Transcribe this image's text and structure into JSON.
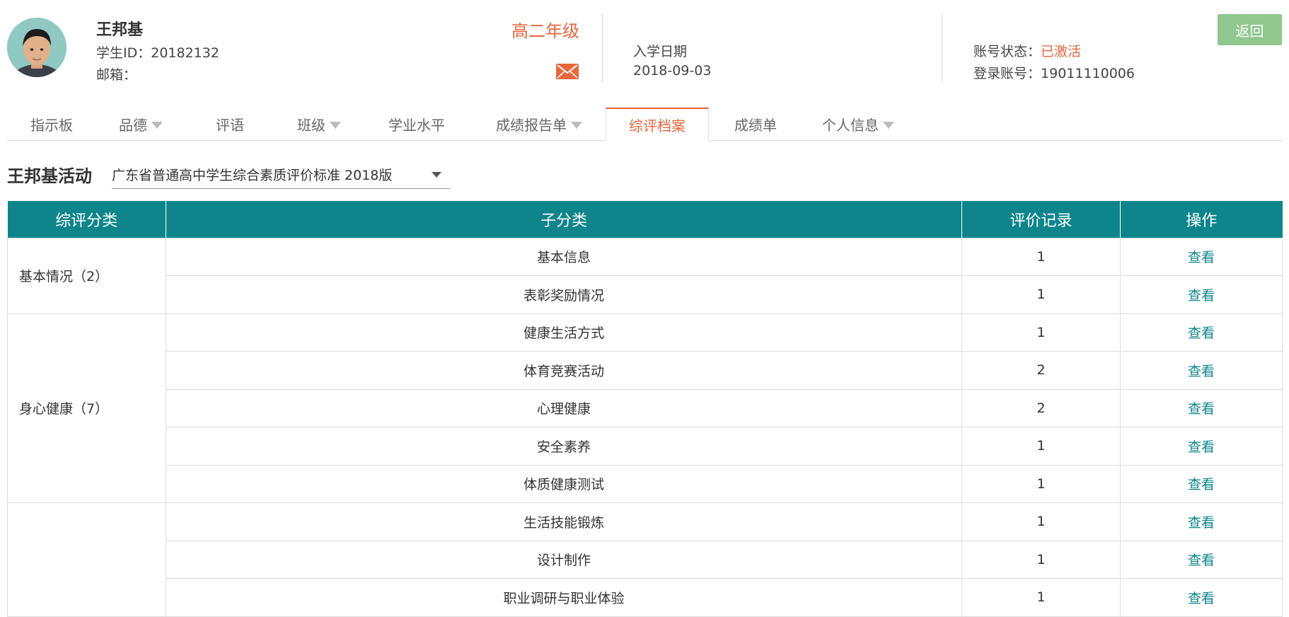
{
  "student": {
    "name": "王邦基",
    "id_text": "学生ID：20182132",
    "email_label": "邮箱：",
    "grade": "高二年级",
    "enroll_label": "入学日期",
    "enroll_date": "2018-09-03",
    "status_label": "账号状态：",
    "status_value": "已激活",
    "login_label": "登录账号：",
    "login_value": "19011110006"
  },
  "header": {
    "back_label": "返回"
  },
  "tabs": [
    {
      "label": "指示板",
      "dropdown": false
    },
    {
      "label": "品德",
      "dropdown": true
    },
    {
      "label": "评语",
      "dropdown": false
    },
    {
      "label": "班级",
      "dropdown": true
    },
    {
      "label": "学业水平",
      "dropdown": false
    },
    {
      "label": "成绩报告单",
      "dropdown": true
    },
    {
      "label": "综评档案",
      "dropdown": false,
      "active": true
    },
    {
      "label": "成绩单",
      "dropdown": false
    },
    {
      "label": "个人信息",
      "dropdown": true
    }
  ],
  "section": {
    "title": "王邦基活动",
    "standard": "广东省普通高中学生综合素质评价标准 2018版"
  },
  "table": {
    "headers": [
      "综评分类",
      "子分类",
      "评价记录",
      "操作"
    ],
    "groups": [
      {
        "category": "基本情况（2）",
        "rows": [
          {
            "sub": "基本信息",
            "count": "1",
            "action": "查看"
          },
          {
            "sub": "表彰奖励情况",
            "count": "1",
            "action": "查看"
          }
        ]
      },
      {
        "category": "身心健康（7）",
        "rows": [
          {
            "sub": "健康生活方式",
            "count": "1",
            "action": "查看"
          },
          {
            "sub": "体育竞赛活动",
            "count": "2",
            "action": "查看"
          },
          {
            "sub": "心理健康",
            "count": "2",
            "action": "查看"
          },
          {
            "sub": "安全素养",
            "count": "1",
            "action": "查看"
          },
          {
            "sub": "体质健康测试",
            "count": "1",
            "action": "查看"
          }
        ]
      },
      {
        "category": "",
        "rows": [
          {
            "sub": "生活技能锻炼",
            "count": "1",
            "action": "查看"
          },
          {
            "sub": "设计制作",
            "count": "1",
            "action": "查看"
          },
          {
            "sub": "职业调研与职业体验",
            "count": "1",
            "action": "查看"
          }
        ]
      }
    ]
  },
  "colors": {
    "accent": "#e8663d",
    "teal": "#0e858b",
    "back_button": "#8fc78e"
  },
  "icons": {
    "avatar": "student-avatar",
    "mail": "mail-icon",
    "caret": "caret-down-icon"
  }
}
